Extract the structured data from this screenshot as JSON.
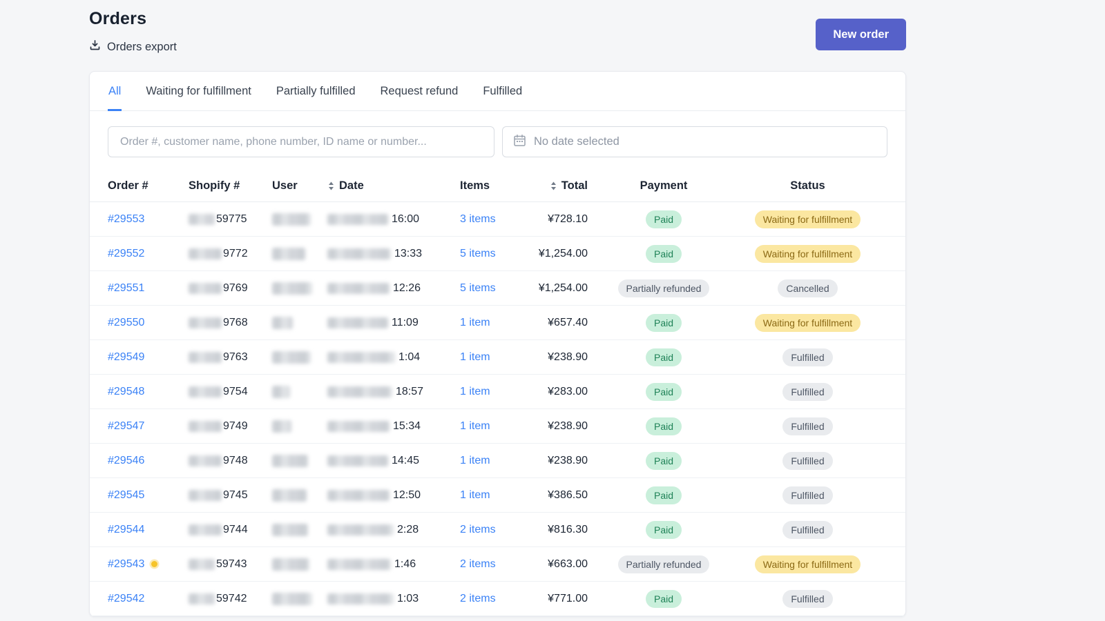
{
  "page": {
    "title": "Orders",
    "export_label": "Orders export",
    "new_order_label": "New order"
  },
  "tabs": [
    {
      "label": "All",
      "active": true
    },
    {
      "label": "Waiting for fulfillment",
      "active": false
    },
    {
      "label": "Partially fulfilled",
      "active": false
    },
    {
      "label": "Request refund",
      "active": false
    },
    {
      "label": "Fulfilled",
      "active": false
    }
  ],
  "filters": {
    "search_placeholder": "Order #, customer name, phone number, ID name or number...",
    "date_placeholder": "No date selected"
  },
  "table": {
    "columns": [
      {
        "label": "Order #",
        "sortable": false
      },
      {
        "label": "Shopify #",
        "sortable": false
      },
      {
        "label": "User",
        "sortable": false
      },
      {
        "label": "Date",
        "sortable": true
      },
      {
        "label": "Items",
        "sortable": false
      },
      {
        "label": "Total",
        "sortable": true
      },
      {
        "label": "Payment",
        "sortable": false
      },
      {
        "label": "Status",
        "sortable": false
      }
    ],
    "rows": [
      {
        "order": "#29553",
        "dot": false,
        "shopify_suffix": "59775",
        "time": "16:00",
        "items": "3 items",
        "total": "¥728.10",
        "payment": {
          "label": "Paid",
          "type": "paid"
        },
        "status": {
          "label": "Waiting for fulfillment",
          "type": "waiting"
        },
        "blur": {
          "shopify": 38,
          "user": 56,
          "date": 88
        }
      },
      {
        "order": "#29552",
        "dot": false,
        "shopify_suffix": "9772",
        "time": "13:33",
        "items": "5 items",
        "total": "¥1,254.00",
        "payment": {
          "label": "Paid",
          "type": "paid"
        },
        "status": {
          "label": "Waiting for fulfillment",
          "type": "waiting"
        },
        "blur": {
          "shopify": 48,
          "user": 48,
          "date": 92
        }
      },
      {
        "order": "#29551",
        "dot": false,
        "shopify_suffix": "9769",
        "time": "12:26",
        "items": "5 items",
        "total": "¥1,254.00",
        "payment": {
          "label": "Partially refunded",
          "type": "neutral"
        },
        "status": {
          "label": "Cancelled",
          "type": "neutral"
        },
        "blur": {
          "shopify": 48,
          "user": 58,
          "date": 90
        }
      },
      {
        "order": "#29550",
        "dot": false,
        "shopify_suffix": "9768",
        "time": "11:09",
        "items": "1 item",
        "total": "¥657.40",
        "payment": {
          "label": "Paid",
          "type": "paid"
        },
        "status": {
          "label": "Waiting for fulfillment",
          "type": "waiting"
        },
        "blur": {
          "shopify": 48,
          "user": 30,
          "date": 88
        }
      },
      {
        "order": "#29549",
        "dot": false,
        "shopify_suffix": "9763",
        "time": "1:04",
        "items": "1 item",
        "total": "¥238.90",
        "payment": {
          "label": "Paid",
          "type": "paid"
        },
        "status": {
          "label": "Fulfilled",
          "type": "neutral"
        },
        "blur": {
          "shopify": 48,
          "user": 56,
          "date": 98
        }
      },
      {
        "order": "#29548",
        "dot": false,
        "shopify_suffix": "9754",
        "time": "18:57",
        "items": "1 item",
        "total": "¥283.00",
        "payment": {
          "label": "Paid",
          "type": "paid"
        },
        "status": {
          "label": "Fulfilled",
          "type": "neutral"
        },
        "blur": {
          "shopify": 48,
          "user": 26,
          "date": 94
        }
      },
      {
        "order": "#29547",
        "dot": false,
        "shopify_suffix": "9749",
        "time": "15:34",
        "items": "1 item",
        "total": "¥238.90",
        "payment": {
          "label": "Paid",
          "type": "paid"
        },
        "status": {
          "label": "Fulfilled",
          "type": "neutral"
        },
        "blur": {
          "shopify": 48,
          "user": 28,
          "date": 90
        }
      },
      {
        "order": "#29546",
        "dot": false,
        "shopify_suffix": "9748",
        "time": "14:45",
        "items": "1 item",
        "total": "¥238.90",
        "payment": {
          "label": "Paid",
          "type": "paid"
        },
        "status": {
          "label": "Fulfilled",
          "type": "neutral"
        },
        "blur": {
          "shopify": 48,
          "user": 52,
          "date": 88
        }
      },
      {
        "order": "#29545",
        "dot": false,
        "shopify_suffix": "9745",
        "time": "12:50",
        "items": "1 item",
        "total": "¥386.50",
        "payment": {
          "label": "Paid",
          "type": "paid"
        },
        "status": {
          "label": "Fulfilled",
          "type": "neutral"
        },
        "blur": {
          "shopify": 48,
          "user": 50,
          "date": 90
        }
      },
      {
        "order": "#29544",
        "dot": false,
        "shopify_suffix": "9744",
        "time": "2:28",
        "items": "2 items",
        "total": "¥816.30",
        "payment": {
          "label": "Paid",
          "type": "paid"
        },
        "status": {
          "label": "Fulfilled",
          "type": "neutral"
        },
        "blur": {
          "shopify": 48,
          "user": 52,
          "date": 96
        }
      },
      {
        "order": "#29543",
        "dot": true,
        "shopify_suffix": "59743",
        "time": "1:46",
        "items": "2 items",
        "total": "¥663.00",
        "payment": {
          "label": "Partially refunded",
          "type": "neutral"
        },
        "status": {
          "label": "Waiting for fulfillment",
          "type": "waiting"
        },
        "blur": {
          "shopify": 38,
          "user": 54,
          "date": 92
        }
      },
      {
        "order": "#29542",
        "dot": false,
        "shopify_suffix": "59742",
        "time": "1:03",
        "items": "2 items",
        "total": "¥771.00",
        "payment": {
          "label": "Paid",
          "type": "paid"
        },
        "status": {
          "label": "Fulfilled",
          "type": "neutral"
        },
        "blur": {
          "shopify": 38,
          "user": 58,
          "date": 96
        }
      }
    ]
  },
  "colors": {
    "accent": "#5661c9",
    "link": "#3b82f6",
    "paid-bg": "#c9efdb",
    "paid-text": "#1f8257",
    "waiting-bg": "#fbe7a1",
    "waiting-text": "#8b6914",
    "neutral-bg": "#e9ebee",
    "neutral-text": "#4d5664"
  }
}
